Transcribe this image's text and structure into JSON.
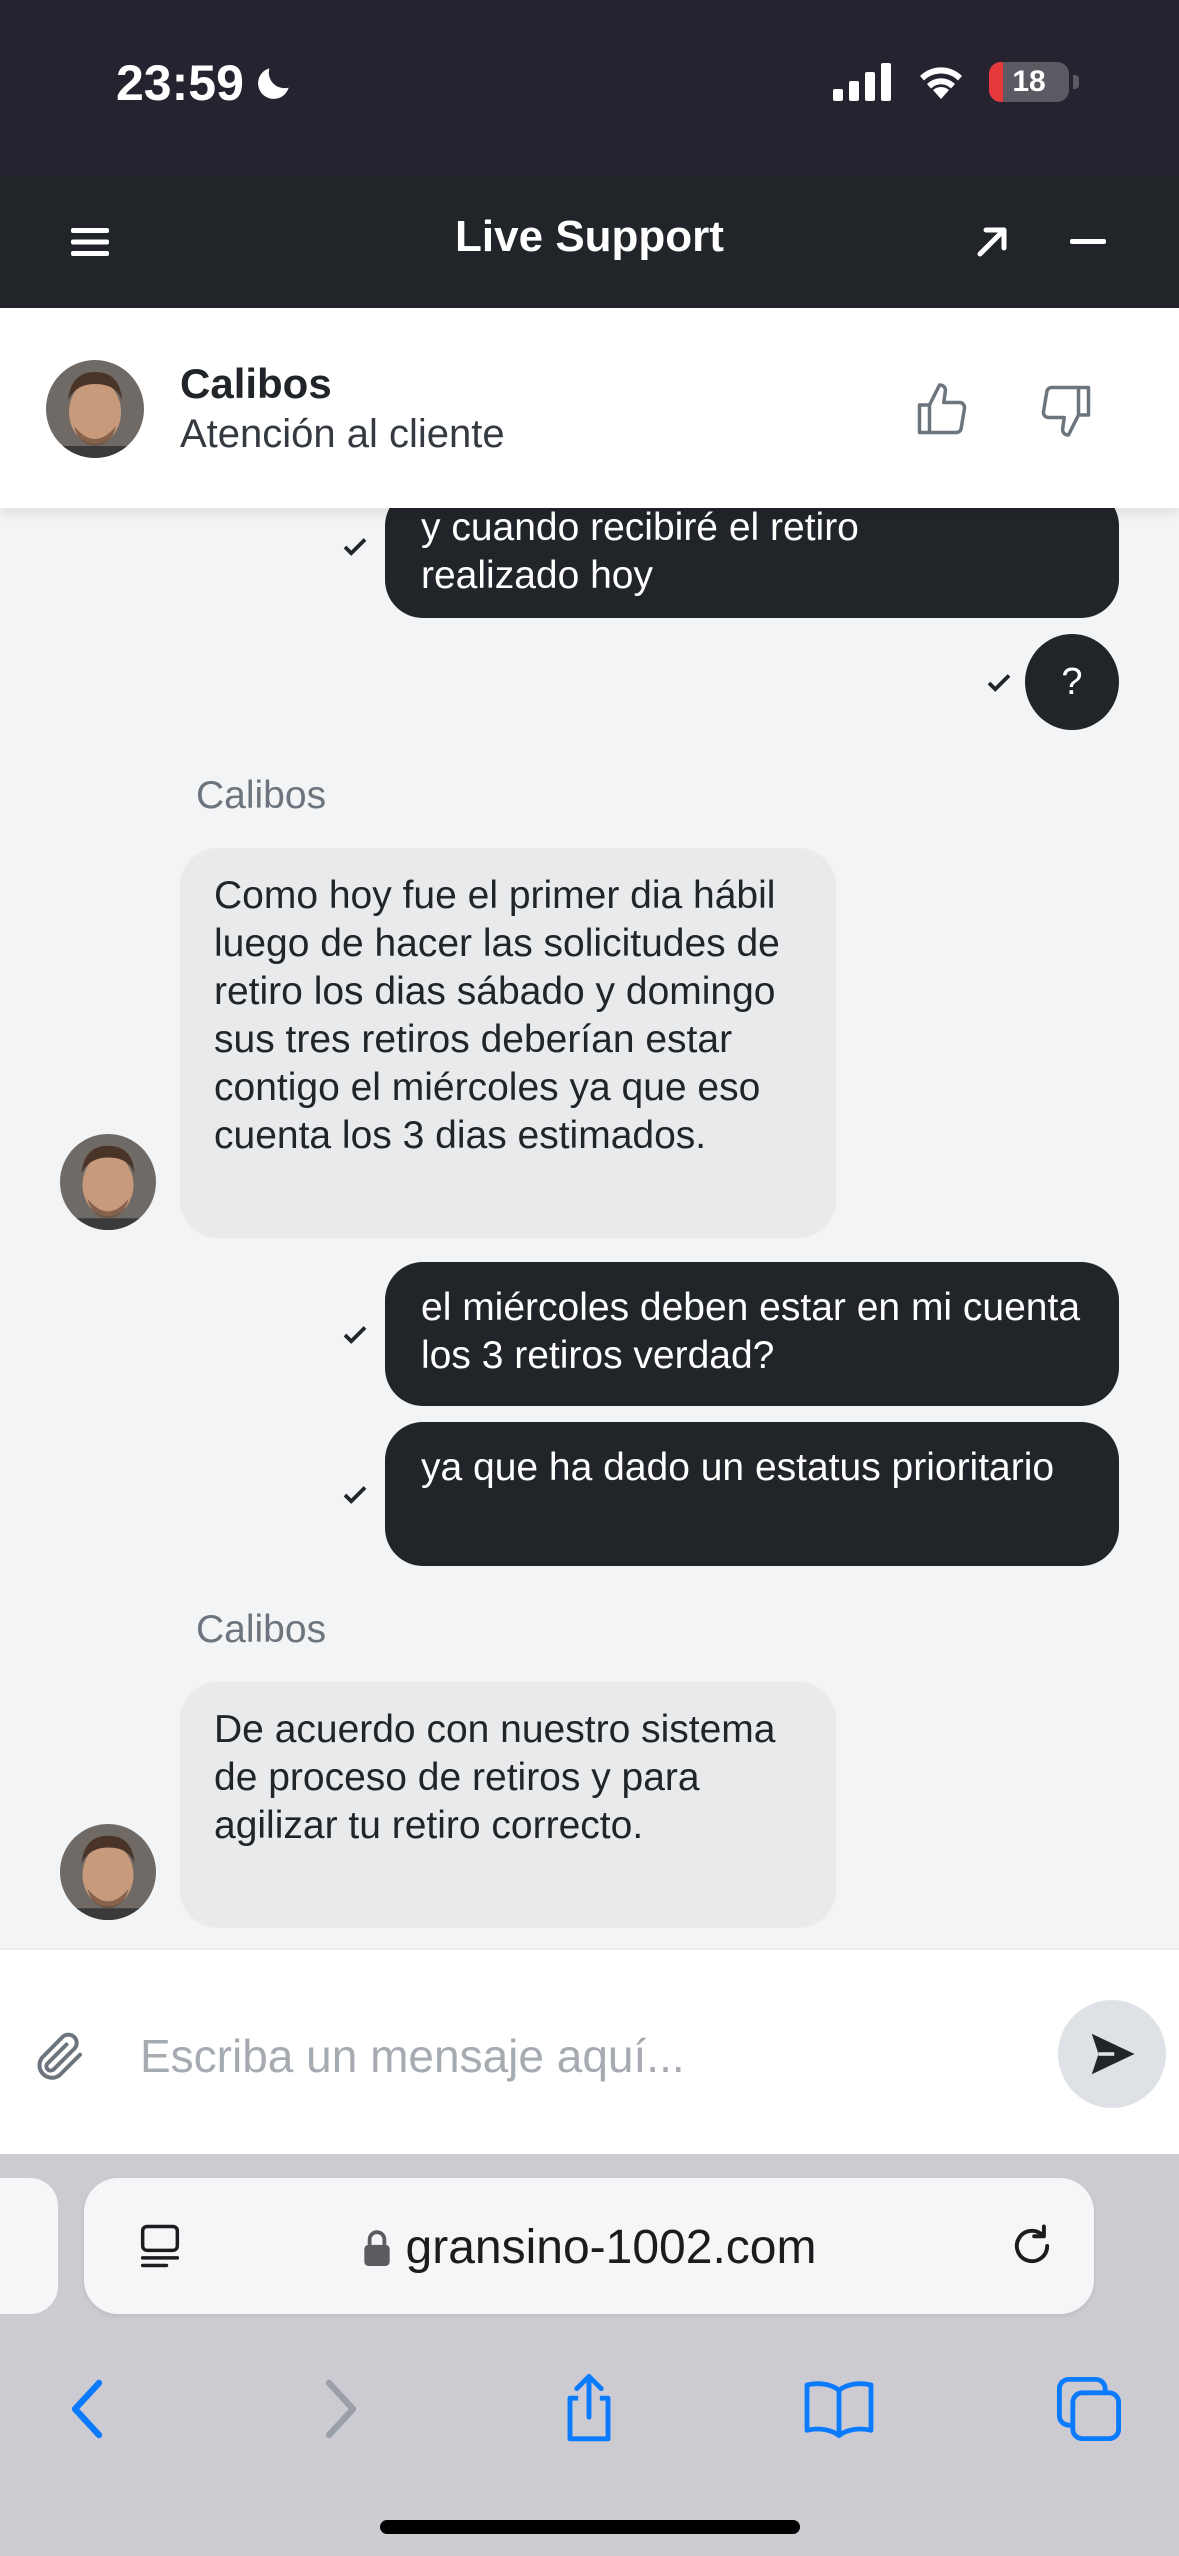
{
  "status_bar": {
    "time": "23:59",
    "battery_level": "18",
    "battery_fraction": 0.18
  },
  "header": {
    "title": "Live Support"
  },
  "agent": {
    "name": "Calibos",
    "role": "Atención al cliente"
  },
  "messages": {
    "out_1_line1": "y cuando recibiré el retiro",
    "out_1_line2": "realizado hoy",
    "out_2": "?",
    "in_1_sender": "Calibos",
    "in_1": "Como hoy fue el primer dia hábil luego de hacer las solicitudes de retiro los dias sábado y domingo sus tres retiros deberían estar contigo el miércoles ya que eso cuenta los 3 dias estimados.",
    "out_3": "el miércoles deben estar en mi cuenta los 3 retiros verdad?",
    "out_4": "ya que ha dado un estatus prioritario",
    "in_2_sender": "Calibos",
    "in_2": "De acuerdo con nuestro sistema de proceso de retiros y para agilizar tu retiro correcto."
  },
  "composer": {
    "placeholder": "Escriba un mensaje aquí..."
  },
  "browser": {
    "url": "gransino-1002.com"
  },
  "colors": {
    "header_bg": "#212529",
    "status_bg": "#27222f",
    "outgoing_bubble": "#212529",
    "incoming_bubble": "#e9eaec",
    "ios_blue": "#0a7aff"
  },
  "icons": {
    "menu": "hamburger-icon",
    "expand": "arrow-up-right-icon",
    "minimize": "minus-icon",
    "like": "thumbs-up-icon",
    "dislike": "thumbs-down-icon",
    "attach": "paperclip-icon",
    "send": "send-icon"
  }
}
